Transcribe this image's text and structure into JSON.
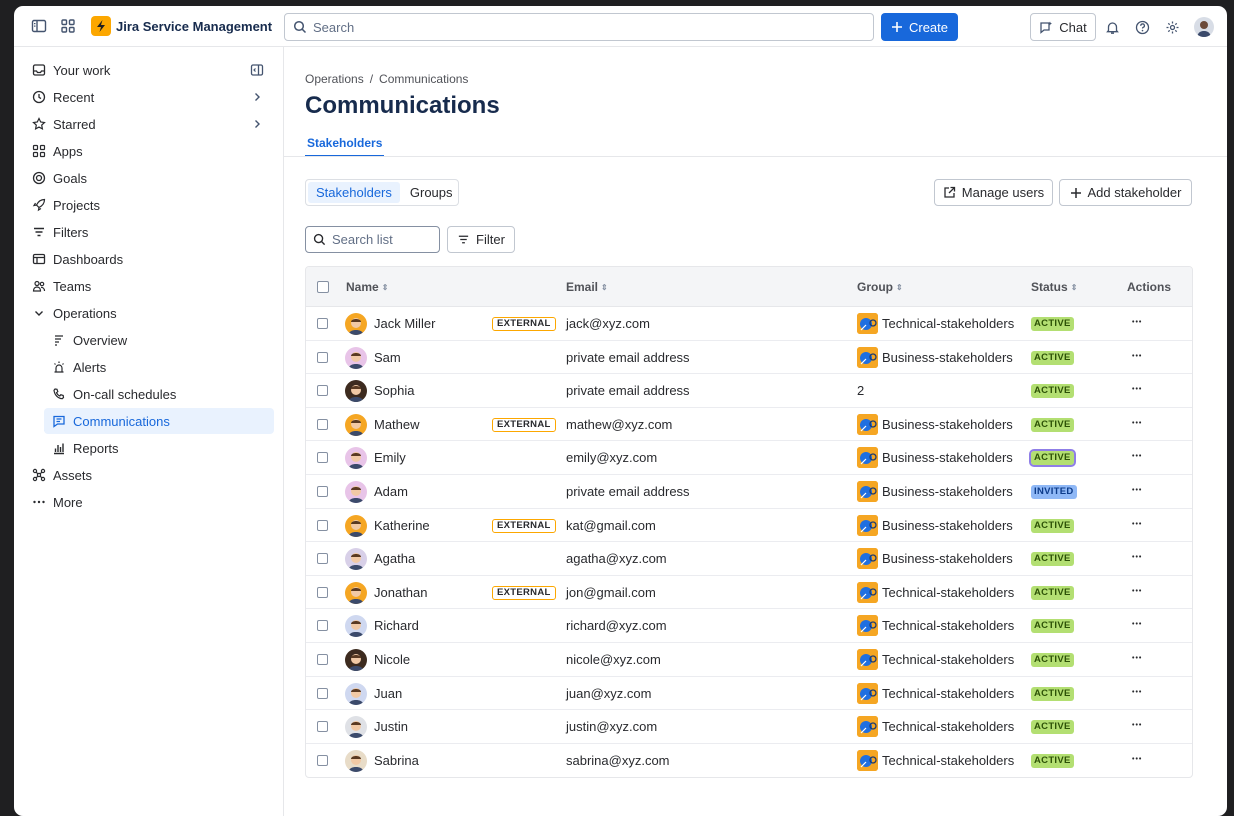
{
  "app": {
    "name": "Jira Service Management"
  },
  "topnav": {
    "search_placeholder": "Search",
    "create_label": "Create",
    "chat_label": "Chat",
    "icons": [
      "sidebar-toggle-icon",
      "app-switcher-icon",
      "bell-icon",
      "help-icon",
      "gear-icon"
    ]
  },
  "sidebar": {
    "items": [
      {
        "label": "Your work",
        "icon": "inbox-icon"
      },
      {
        "label": "Recent",
        "icon": "clock-icon"
      },
      {
        "label": "Starred",
        "icon": "star-icon"
      },
      {
        "label": "Apps",
        "icon": "apps-icon"
      },
      {
        "label": "Goals",
        "icon": "goal-icon"
      },
      {
        "label": "Projects",
        "icon": "rocket-icon"
      },
      {
        "label": "Filters",
        "icon": "filter-icon"
      },
      {
        "label": "Dashboards",
        "icon": "dashboard-icon"
      },
      {
        "label": "Teams",
        "icon": "teams-icon"
      },
      {
        "label": "Operations",
        "icon": "chevron-down-icon"
      },
      {
        "label": "Overview",
        "icon": "overview-icon"
      },
      {
        "label": "Alerts",
        "icon": "siren-icon"
      },
      {
        "label": "On-call schedules",
        "icon": "phone-icon"
      },
      {
        "label": "Communications",
        "icon": "message-icon"
      },
      {
        "label": "Reports",
        "icon": "chart-icon"
      },
      {
        "label": "Assets",
        "icon": "assets-icon"
      },
      {
        "label": "More",
        "icon": "more-icon"
      }
    ]
  },
  "breadcrumb": {
    "parent": "Operations",
    "separator": "/",
    "current": "Communications"
  },
  "page": {
    "title": "Communications",
    "tab": "Stakeholders"
  },
  "segmented": {
    "options": [
      "Stakeholders",
      "Groups"
    ],
    "selected": "Stakeholders"
  },
  "actions": {
    "manage_users": "Manage users",
    "add_stakeholder": "Add stakeholder"
  },
  "toolbar": {
    "search_placeholder": "Search list",
    "filter_label": "Filter"
  },
  "table": {
    "headers": {
      "name": "Name",
      "email": "Email",
      "group": "Group",
      "status": "Status",
      "actions": "Actions"
    },
    "external_label": "EXTERNAL",
    "rows": [
      {
        "name": "Jack Miller",
        "external": true,
        "email": "jack@xyz.com",
        "group": "Technical-stakeholders",
        "status": "ACTIVE",
        "avatar_color": "#f5a623"
      },
      {
        "name": "Sam",
        "external": false,
        "email": "private email address",
        "group": "Business-stakeholders",
        "status": "ACTIVE",
        "avatar_color": "#e8c4e8"
      },
      {
        "name": "Sophia",
        "external": false,
        "email": "private email address",
        "group": "2",
        "status": "ACTIVE",
        "avatar_color": "#3d2b1f"
      },
      {
        "name": "Mathew",
        "external": true,
        "email": "mathew@xyz.com",
        "group": "Business-stakeholders",
        "status": "ACTIVE",
        "avatar_color": "#f5a623"
      },
      {
        "name": "Emily",
        "external": false,
        "email": "emily@xyz.com",
        "group": "Business-stakeholders",
        "status": "ACTIVE",
        "avatar_color": "#e8c4e8"
      },
      {
        "name": "Adam",
        "external": false,
        "email": "private email address",
        "group": "Business-stakeholders",
        "status": "INVITED",
        "avatar_color": "#e8c4e8"
      },
      {
        "name": "Katherine",
        "external": true,
        "email": "kat@gmail.com",
        "group": "Business-stakeholders",
        "status": "ACTIVE",
        "avatar_color": "#f5a623"
      },
      {
        "name": "Agatha",
        "external": false,
        "email": "agatha@xyz.com",
        "group": "Business-stakeholders",
        "status": "ACTIVE",
        "avatar_color": "#d8d0e8"
      },
      {
        "name": "Jonathan",
        "external": true,
        "email": "jon@gmail.com",
        "group": "Technical-stakeholders",
        "status": "ACTIVE",
        "avatar_color": "#f5a623"
      },
      {
        "name": "Richard",
        "external": false,
        "email": "richard@xyz.com",
        "group": "Technical-stakeholders",
        "status": "ACTIVE",
        "avatar_color": "#cfd8f0"
      },
      {
        "name": "Nicole",
        "external": false,
        "email": "nicole@xyz.com",
        "group": "Technical-stakeholders",
        "status": "ACTIVE",
        "avatar_color": "#3d2b1f"
      },
      {
        "name": "Juan",
        "external": false,
        "email": "juan@xyz.com",
        "group": "Technical-stakeholders",
        "status": "ACTIVE",
        "avatar_color": "#cfd8f0"
      },
      {
        "name": "Justin",
        "external": false,
        "email": "justin@xyz.com",
        "group": "Technical-stakeholders",
        "status": "ACTIVE",
        "avatar_color": "#dfe1e6"
      },
      {
        "name": "Sabrina",
        "external": false,
        "email": "sabrina@xyz.com",
        "group": "Technical-stakeholders",
        "status": "ACTIVE",
        "avatar_color": "#e8dcc8"
      }
    ]
  },
  "colors": {
    "brand": "#1868db",
    "logo": "#fca700",
    "active_badge": "#b3df72",
    "invited_badge": "#8fb8f6"
  }
}
